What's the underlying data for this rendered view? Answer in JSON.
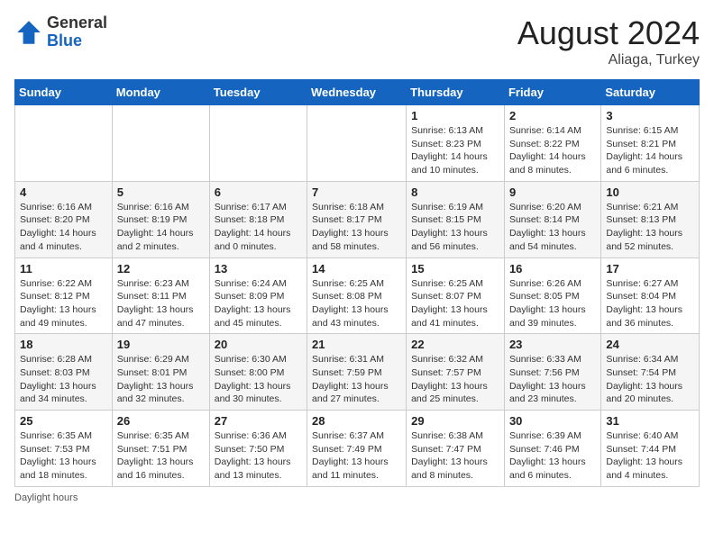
{
  "header": {
    "logo_general": "General",
    "logo_blue": "Blue",
    "month_year": "August 2024",
    "location": "Aliaga, Turkey"
  },
  "footer": {
    "note": "Daylight hours"
  },
  "days_of_week": [
    "Sunday",
    "Monday",
    "Tuesday",
    "Wednesday",
    "Thursday",
    "Friday",
    "Saturday"
  ],
  "weeks": [
    [
      {
        "day": "",
        "sunrise": "",
        "sunset": "",
        "daylight": ""
      },
      {
        "day": "",
        "sunrise": "",
        "sunset": "",
        "daylight": ""
      },
      {
        "day": "",
        "sunrise": "",
        "sunset": "",
        "daylight": ""
      },
      {
        "day": "",
        "sunrise": "",
        "sunset": "",
        "daylight": ""
      },
      {
        "day": "1",
        "sunrise": "Sunrise: 6:13 AM",
        "sunset": "Sunset: 8:23 PM",
        "daylight": "Daylight: 14 hours and 10 minutes."
      },
      {
        "day": "2",
        "sunrise": "Sunrise: 6:14 AM",
        "sunset": "Sunset: 8:22 PM",
        "daylight": "Daylight: 14 hours and 8 minutes."
      },
      {
        "day": "3",
        "sunrise": "Sunrise: 6:15 AM",
        "sunset": "Sunset: 8:21 PM",
        "daylight": "Daylight: 14 hours and 6 minutes."
      }
    ],
    [
      {
        "day": "4",
        "sunrise": "Sunrise: 6:16 AM",
        "sunset": "Sunset: 8:20 PM",
        "daylight": "Daylight: 14 hours and 4 minutes."
      },
      {
        "day": "5",
        "sunrise": "Sunrise: 6:16 AM",
        "sunset": "Sunset: 8:19 PM",
        "daylight": "Daylight: 14 hours and 2 minutes."
      },
      {
        "day": "6",
        "sunrise": "Sunrise: 6:17 AM",
        "sunset": "Sunset: 8:18 PM",
        "daylight": "Daylight: 14 hours and 0 minutes."
      },
      {
        "day": "7",
        "sunrise": "Sunrise: 6:18 AM",
        "sunset": "Sunset: 8:17 PM",
        "daylight": "Daylight: 13 hours and 58 minutes."
      },
      {
        "day": "8",
        "sunrise": "Sunrise: 6:19 AM",
        "sunset": "Sunset: 8:15 PM",
        "daylight": "Daylight: 13 hours and 56 minutes."
      },
      {
        "day": "9",
        "sunrise": "Sunrise: 6:20 AM",
        "sunset": "Sunset: 8:14 PM",
        "daylight": "Daylight: 13 hours and 54 minutes."
      },
      {
        "day": "10",
        "sunrise": "Sunrise: 6:21 AM",
        "sunset": "Sunset: 8:13 PM",
        "daylight": "Daylight: 13 hours and 52 minutes."
      }
    ],
    [
      {
        "day": "11",
        "sunrise": "Sunrise: 6:22 AM",
        "sunset": "Sunset: 8:12 PM",
        "daylight": "Daylight: 13 hours and 49 minutes."
      },
      {
        "day": "12",
        "sunrise": "Sunrise: 6:23 AM",
        "sunset": "Sunset: 8:11 PM",
        "daylight": "Daylight: 13 hours and 47 minutes."
      },
      {
        "day": "13",
        "sunrise": "Sunrise: 6:24 AM",
        "sunset": "Sunset: 8:09 PM",
        "daylight": "Daylight: 13 hours and 45 minutes."
      },
      {
        "day": "14",
        "sunrise": "Sunrise: 6:25 AM",
        "sunset": "Sunset: 8:08 PM",
        "daylight": "Daylight: 13 hours and 43 minutes."
      },
      {
        "day": "15",
        "sunrise": "Sunrise: 6:25 AM",
        "sunset": "Sunset: 8:07 PM",
        "daylight": "Daylight: 13 hours and 41 minutes."
      },
      {
        "day": "16",
        "sunrise": "Sunrise: 6:26 AM",
        "sunset": "Sunset: 8:05 PM",
        "daylight": "Daylight: 13 hours and 39 minutes."
      },
      {
        "day": "17",
        "sunrise": "Sunrise: 6:27 AM",
        "sunset": "Sunset: 8:04 PM",
        "daylight": "Daylight: 13 hours and 36 minutes."
      }
    ],
    [
      {
        "day": "18",
        "sunrise": "Sunrise: 6:28 AM",
        "sunset": "Sunset: 8:03 PM",
        "daylight": "Daylight: 13 hours and 34 minutes."
      },
      {
        "day": "19",
        "sunrise": "Sunrise: 6:29 AM",
        "sunset": "Sunset: 8:01 PM",
        "daylight": "Daylight: 13 hours and 32 minutes."
      },
      {
        "day": "20",
        "sunrise": "Sunrise: 6:30 AM",
        "sunset": "Sunset: 8:00 PM",
        "daylight": "Daylight: 13 hours and 30 minutes."
      },
      {
        "day": "21",
        "sunrise": "Sunrise: 6:31 AM",
        "sunset": "Sunset: 7:59 PM",
        "daylight": "Daylight: 13 hours and 27 minutes."
      },
      {
        "day": "22",
        "sunrise": "Sunrise: 6:32 AM",
        "sunset": "Sunset: 7:57 PM",
        "daylight": "Daylight: 13 hours and 25 minutes."
      },
      {
        "day": "23",
        "sunrise": "Sunrise: 6:33 AM",
        "sunset": "Sunset: 7:56 PM",
        "daylight": "Daylight: 13 hours and 23 minutes."
      },
      {
        "day": "24",
        "sunrise": "Sunrise: 6:34 AM",
        "sunset": "Sunset: 7:54 PM",
        "daylight": "Daylight: 13 hours and 20 minutes."
      }
    ],
    [
      {
        "day": "25",
        "sunrise": "Sunrise: 6:35 AM",
        "sunset": "Sunset: 7:53 PM",
        "daylight": "Daylight: 13 hours and 18 minutes."
      },
      {
        "day": "26",
        "sunrise": "Sunrise: 6:35 AM",
        "sunset": "Sunset: 7:51 PM",
        "daylight": "Daylight: 13 hours and 16 minutes."
      },
      {
        "day": "27",
        "sunrise": "Sunrise: 6:36 AM",
        "sunset": "Sunset: 7:50 PM",
        "daylight": "Daylight: 13 hours and 13 minutes."
      },
      {
        "day": "28",
        "sunrise": "Sunrise: 6:37 AM",
        "sunset": "Sunset: 7:49 PM",
        "daylight": "Daylight: 13 hours and 11 minutes."
      },
      {
        "day": "29",
        "sunrise": "Sunrise: 6:38 AM",
        "sunset": "Sunset: 7:47 PM",
        "daylight": "Daylight: 13 hours and 8 minutes."
      },
      {
        "day": "30",
        "sunrise": "Sunrise: 6:39 AM",
        "sunset": "Sunset: 7:46 PM",
        "daylight": "Daylight: 13 hours and 6 minutes."
      },
      {
        "day": "31",
        "sunrise": "Sunrise: 6:40 AM",
        "sunset": "Sunset: 7:44 PM",
        "daylight": "Daylight: 13 hours and 4 minutes."
      }
    ]
  ]
}
